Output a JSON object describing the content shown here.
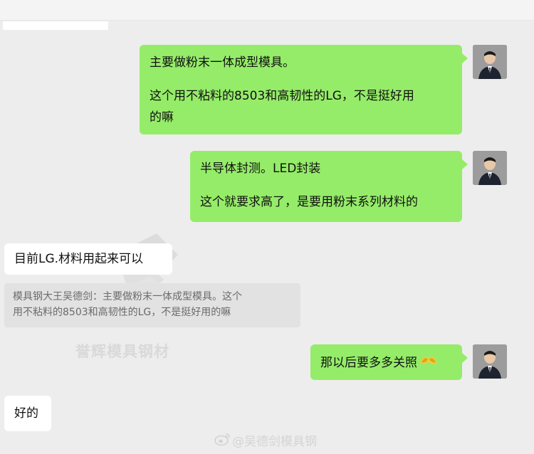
{
  "chat": {
    "messages": [
      {
        "direction": "outgoing",
        "lines": [
          "主要做粉末一体成型模具。",
          "",
          "这个用不粘料的8503和高韧性的LG，不是挺好用",
          "的嘛"
        ]
      },
      {
        "direction": "outgoing",
        "lines": [
          "半导体封测。LED封装",
          "",
          "这个就要求高了，是要用粉末系列材料的"
        ]
      },
      {
        "direction": "incoming",
        "lines": [
          "目前LG.材料用起来可以"
        ],
        "quote_lines": [
          "模具钢大王吴德剑：主要做粉末一体成型模具。这个",
          "用不粘料的8503和高韧性的LG，不是挺好用的嘛"
        ]
      },
      {
        "direction": "outgoing",
        "lines": [
          "那以后要多多关照"
        ],
        "emoji": "sunglasses-emoji"
      },
      {
        "direction": "incoming",
        "lines": [
          "好的"
        ]
      }
    ]
  },
  "watermark": {
    "center_text": "誉辉模具钢材",
    "weibo_text": "@吴德剑模具钢"
  },
  "colors": {
    "background": "#ededed",
    "outgoing_bubble": "#95ec69",
    "incoming_bubble": "#ffffff",
    "quote_bg": "#e2e2e2"
  },
  "icons": {
    "avatar": "avatar-man-in-suit",
    "emoji": "sunglasses-emoji",
    "weibo": "weibo-icon"
  }
}
